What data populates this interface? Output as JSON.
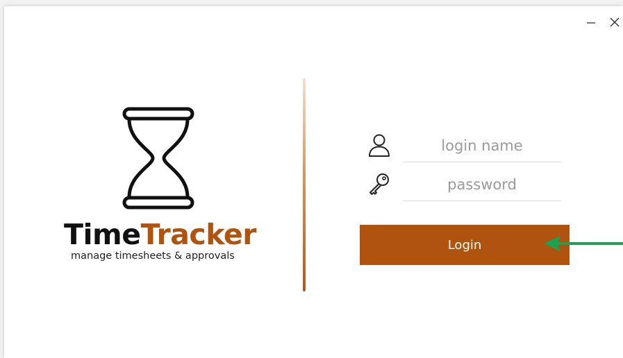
{
  "window": {
    "minimize_glyph": "—",
    "close_glyph": "✕"
  },
  "branding": {
    "name_part1": "Time",
    "name_part2": "Tracker",
    "tagline": "manage timesheets & approvals",
    "logo_icon": "hourglass-icon"
  },
  "form": {
    "username": {
      "placeholder": "login name",
      "value": "",
      "icon": "user-icon"
    },
    "password": {
      "placeholder": "password",
      "value": "",
      "icon": "key-icon"
    },
    "login_label": "Login"
  },
  "annotation": {
    "icon": "pointer-arrow-icon"
  },
  "colors": {
    "accent": "#b0530f",
    "arrow": "#1aa352",
    "text_dark": "#111111",
    "placeholder": "#9a9a9a"
  }
}
